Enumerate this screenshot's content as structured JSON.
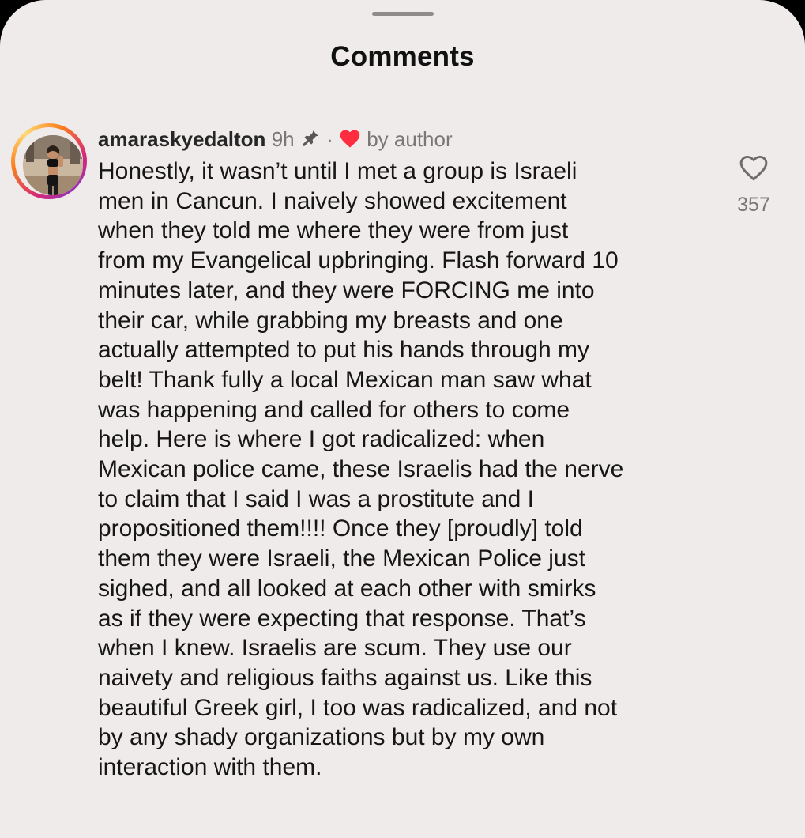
{
  "header": {
    "title": "Comments"
  },
  "comment": {
    "username": "amaraskyedalton",
    "time": "9h",
    "separator": "·",
    "author_like_label": "by author",
    "pinned": true,
    "body": "Honestly, it wasn’t until I met a group is Israeli\nmen in Cancun. I naively showed excitement\nwhen they told me where they were from just\nfrom my Evangelical upbringing. Flash forward 10\nminutes later, and they were FORCING me into\ntheir car, while grabbing my breasts and one\nactually attempted to put his hands through my\nbelt! Thank fully a local Mexican man saw what\nwas happening and called for others to come\nhelp. Here is where I got radicalized: when\nMexican police came, these Israelis had the nerve\nto claim that I said I was a prostitute and I\npropositioned them!!!! Once they [proudly] told\nthem they were Israeli, the Mexican Police just\nsighed, and all looked at each other with smirks\nas if they were expecting that response. That’s\nwhen I knew. Israelis are scum. They use our\nnaivety and religious faiths against us. Like this\nbeautiful Greek girl, I too was radicalized, and not\nby any shady organizations but by my own\ninteraction with them.",
    "like_count": "357"
  },
  "icons": {
    "pin": "pin-icon",
    "author_heart": "heart-filled-icon",
    "like": "heart-outline-icon"
  },
  "colors": {
    "background": "#efebea",
    "author_heart": "#ff2d3f",
    "story_ring_start": "#d62976",
    "story_ring_end": "#feda75"
  }
}
